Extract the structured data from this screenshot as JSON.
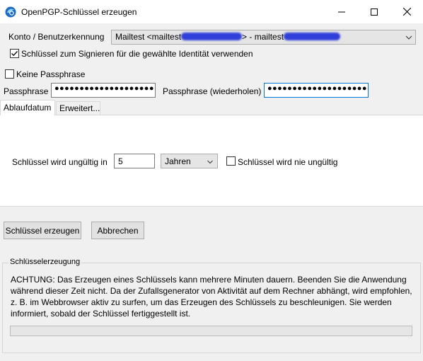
{
  "window": {
    "title": "OpenPGP-Schlüssel erzeugen"
  },
  "identity": {
    "account_label": "Konto / Benutzerkennung",
    "account_value_prefix": "Mailtest <mailtest",
    "account_value_mid": "> - mailtest",
    "sign_with_identity_label": "Schlüssel zum Signieren für die gewählte Identität verwenden",
    "sign_with_identity_checked": true
  },
  "passphrase": {
    "no_passphrase_label": "Keine Passphrase",
    "no_passphrase_checked": false,
    "passphrase_label": "Passphrase",
    "passphrase_value": "●●●●●●●●●●●●●●●●●●●●",
    "repeat_label": "Passphrase (wiederholen)",
    "repeat_value": "●●●●●●●●●●●●●●●●●●●●"
  },
  "tabs": [
    {
      "label": "Ablaufdatum",
      "active": true
    },
    {
      "label": "Erweitert...",
      "active": false
    }
  ],
  "expiry": {
    "expires_in_label": "Schlüssel wird ungültig in",
    "expires_in_value": "5",
    "unit_value": "Jahren",
    "never_expires_label": "Schlüssel wird nie ungültig",
    "never_expires_checked": false
  },
  "buttons": {
    "generate_label": "Schlüssel erzeugen",
    "cancel_label": "Abbrechen"
  },
  "generation": {
    "group_label": "Schlüsselerzeugung",
    "notice": "ACHTUNG: Das Erzeugen eines Schlüssels kann mehrere Minuten dauern. Beenden Sie die Anwendung während dieser Zeit nicht. Da der Zufallsgenerator von Aktivität auf dem Rechner abhängt, wird empfohlen, z. B. im Webbrowser aktiv zu surfen, um das Erzeugen des Schlüssels zu beschleunigen. Sie werden informiert, sobald der Schlüssel fertiggestellt ist.",
    "progress": 0
  },
  "icons": {
    "app": "thunderbird-icon",
    "minimize": "minimize-icon",
    "maximize": "maximize-icon",
    "close": "close-icon",
    "checkmark": "checkmark-icon",
    "dropdown": "chevron-down-icon"
  },
  "colors": {
    "focus_border": "#0078d7",
    "redaction": "#2f3fd9",
    "progress_fill": "#06b025"
  }
}
